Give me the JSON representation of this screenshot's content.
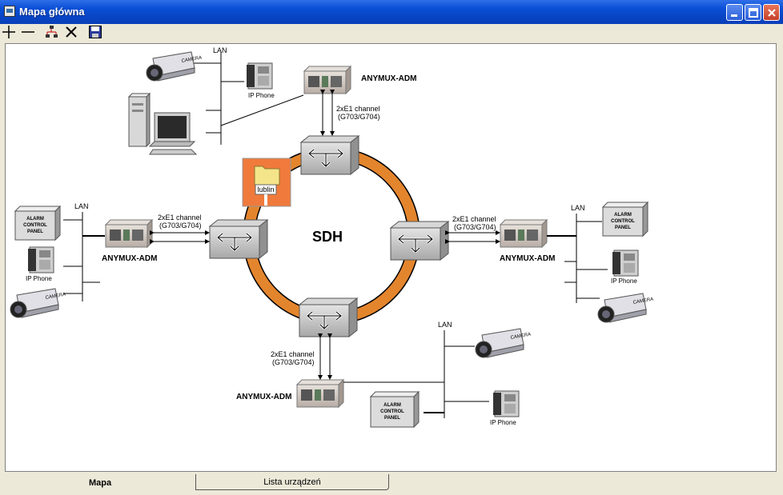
{
  "window": {
    "title": "Mapa główna"
  },
  "diagram": {
    "center_label": "SDH",
    "folder_label": "lublin",
    "lan_label": "LAN",
    "adm_label": "ANYMUX-ADM",
    "channel_line1": "2xE1 channel",
    "channel_line2": "(G703/G704)",
    "ip_phone_label": "IP Phone",
    "alarm_line1": "ALARM",
    "alarm_line2": "CONTROL",
    "alarm_line3": "PANEL",
    "camera_label": "CAMERA"
  },
  "tabs": [
    {
      "label": "Mapa"
    },
    {
      "label": "Lista urządzeń"
    }
  ]
}
